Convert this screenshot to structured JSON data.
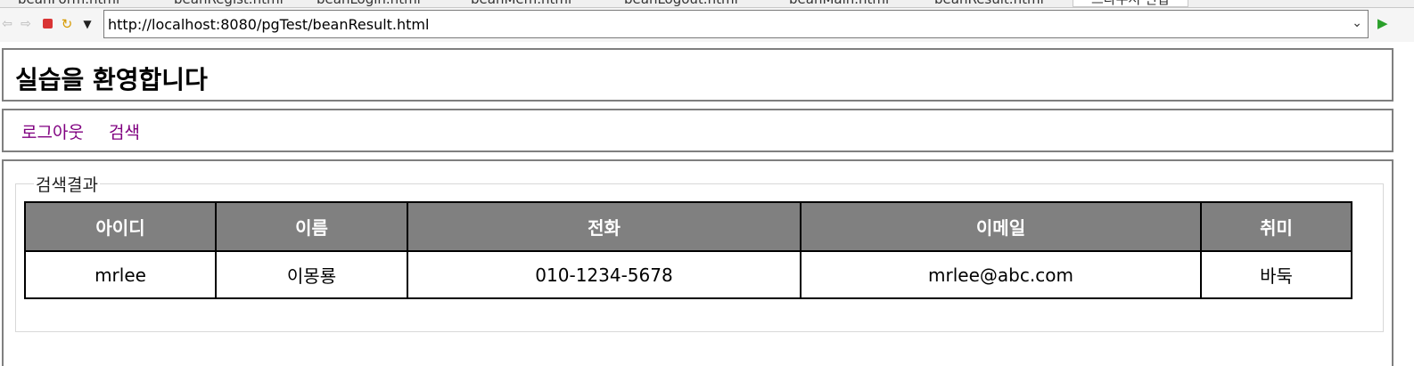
{
  "tabs": [
    {
      "label": "beanForm.html",
      "active": false
    },
    {
      "label": "beanRegist.html",
      "active": false
    },
    {
      "label": "beanLogin.html",
      "active": false
    },
    {
      "label": "beanMem.html",
      "active": false
    },
    {
      "label": "beanLogout.html",
      "active": false
    },
    {
      "label": "beanMain.html",
      "active": false
    },
    {
      "label": "beanResult.html",
      "active": false
    },
    {
      "label": "브라우저 편집",
      "active": true
    }
  ],
  "toolbar": {
    "url": "http://localhost:8080/pgTest/beanResult.html",
    "icons": {
      "back": "back-arrow-icon",
      "forward": "forward-arrow-icon",
      "stop": "stop-icon",
      "refresh": "refresh-icon",
      "menu": "dropdown-icon",
      "go": "go-icon"
    }
  },
  "page": {
    "title": "실습을 환영합니다",
    "menu": [
      "로그아웃",
      "검색"
    ],
    "legend": "검색결과",
    "table": {
      "headers": [
        "아이디",
        "이름",
        "전화",
        "이메일",
        "취미"
      ],
      "rows": [
        [
          "mrlee",
          "이몽룡",
          "010-1234-5678",
          "mrlee@abc.com",
          "바둑"
        ]
      ]
    }
  },
  "colors": {
    "header_bg": "#808080",
    "link": "#800080",
    "frame_border": "#7f7f7f"
  }
}
